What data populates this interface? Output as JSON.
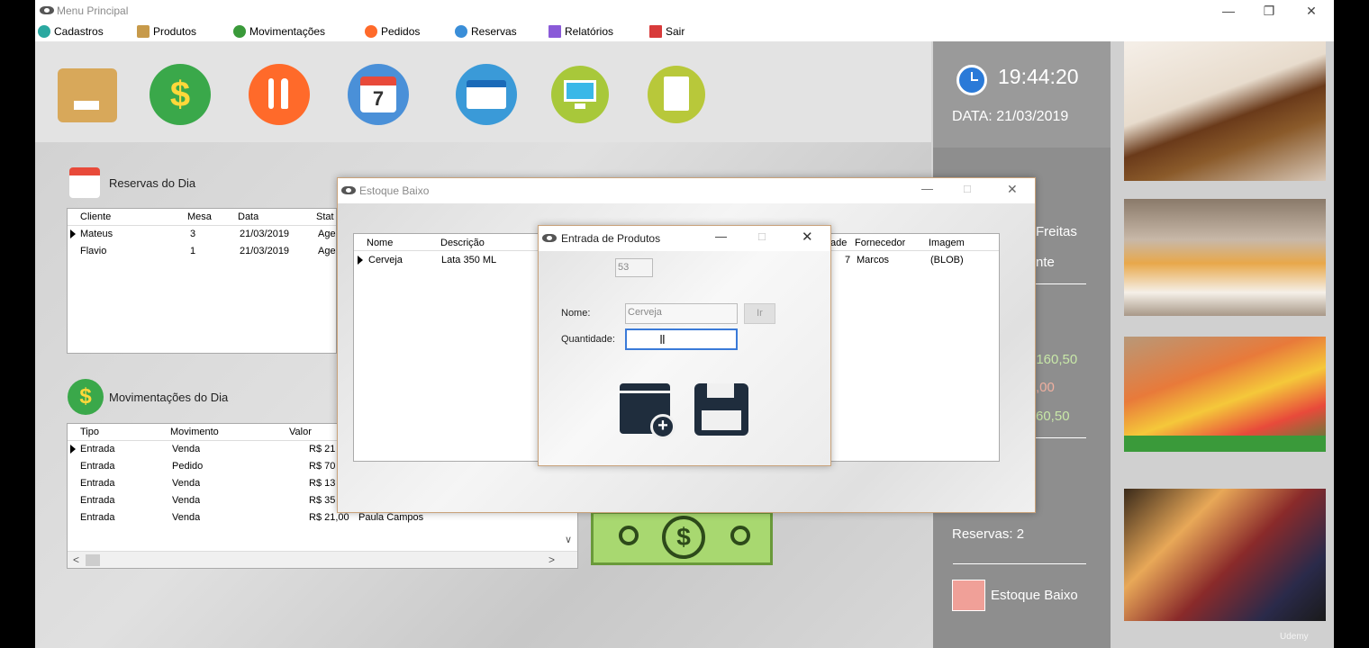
{
  "window": {
    "title": "Menu Principal"
  },
  "menu": [
    {
      "label": "Cadastros",
      "color": "#2aa8a0"
    },
    {
      "label": "Produtos",
      "color": "#c79a4a"
    },
    {
      "label": "Movimentações",
      "color": "#3a9a3a"
    },
    {
      "label": "Pedidos",
      "color": "#ff6a2a"
    },
    {
      "label": "Reservas",
      "color": "#3a8ed8"
    },
    {
      "label": "Relatórios",
      "color": "#8a5ad8"
    },
    {
      "label": "Sair",
      "color": "#d83a3a"
    }
  ],
  "toolbar": [
    {
      "name": "product-box-icon",
      "color": "#d8a85a"
    },
    {
      "name": "dollar-icon",
      "color": "#3aa84a"
    },
    {
      "name": "utensils-icon",
      "color": "#ff6a2a"
    },
    {
      "name": "calendar-icon",
      "color": "#4a90d8"
    },
    {
      "name": "table-calendar-icon",
      "color": "#3a9ad8"
    },
    {
      "name": "monitor-icon",
      "color": "#a8c83a"
    },
    {
      "name": "report-icon",
      "color": "#b8c83a"
    }
  ],
  "info": {
    "time": "19:44:20",
    "date": "DATA: 21/03/2019",
    "user_fragment": "Freitas",
    "role_fragment": "nte",
    "value1": ": 160,50",
    "value2": ",00",
    "value3": "60,50",
    "reservas": "Reservas:  2",
    "estoque_baixo": "Estoque Baixo"
  },
  "reservas": {
    "title": "Reservas do Dia",
    "columns": [
      "Cliente",
      "Mesa",
      "Data",
      "Stat"
    ],
    "rows": [
      [
        "Mateus",
        "3",
        "21/03/2019",
        "Age"
      ],
      [
        "Flavio",
        "1",
        "21/03/2019",
        "Age"
      ]
    ]
  },
  "movimentacoes": {
    "title": "Movimentações do Dia",
    "columns": [
      "Tipo",
      "Movimento",
      "Valor"
    ],
    "rows": [
      [
        "Entrada",
        "Venda",
        "R$ 21",
        ""
      ],
      [
        "Entrada",
        "Pedido",
        "R$ 70",
        ""
      ],
      [
        "Entrada",
        "Venda",
        "R$ 13",
        ""
      ],
      [
        "Entrada",
        "Venda",
        "R$ 35",
        ""
      ],
      [
        "Entrada",
        "Venda",
        "R$ 21,00",
        "Paula Campos"
      ]
    ]
  },
  "estoque": {
    "title": "Estoque Baixo",
    "columns": [
      "Nome",
      "Descrição",
      "ade",
      "Fornecedor",
      "Imagem"
    ],
    "rows": [
      [
        "Cerveja",
        "Lata 350 ML",
        "7",
        "Marcos",
        "(BLOB)"
      ]
    ]
  },
  "entrada": {
    "title": "Entrada de Produtos",
    "id_value": "53",
    "nome_label": "Nome:",
    "nome_value": "Cerveja",
    "ir_label": "Ir",
    "quantidade_label": "Quantidade:",
    "quantidade_value": ""
  },
  "watermark": "Udemy"
}
